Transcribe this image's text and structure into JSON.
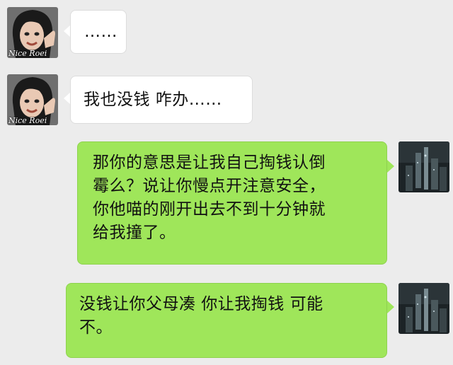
{
  "messages": [
    {
      "side": "in",
      "lines": [
        "……"
      ]
    },
    {
      "side": "in",
      "lines": [
        "我也没钱 咋办……"
      ]
    },
    {
      "side": "out",
      "lines": [
        "那你的意思是让我自己掏钱认倒",
        "霉么？说让你慢点开注意安全，",
        "你他喵的刚开出去不到十分钟就",
        "给我撞了。"
      ]
    },
    {
      "side": "out",
      "lines": [
        "没钱让你父母凑 你让我掏钱 可能",
        "不。"
      ]
    }
  ],
  "contact_avatar": {
    "watermark": "Nice Roei",
    "icon": "girl-thumbs-up-avatar"
  },
  "self_avatar": {
    "icon": "night-city-avatar"
  },
  "colors": {
    "background": "#ececec",
    "incoming_bubble": "#ffffff",
    "outgoing_bubble": "#9fe65a"
  }
}
